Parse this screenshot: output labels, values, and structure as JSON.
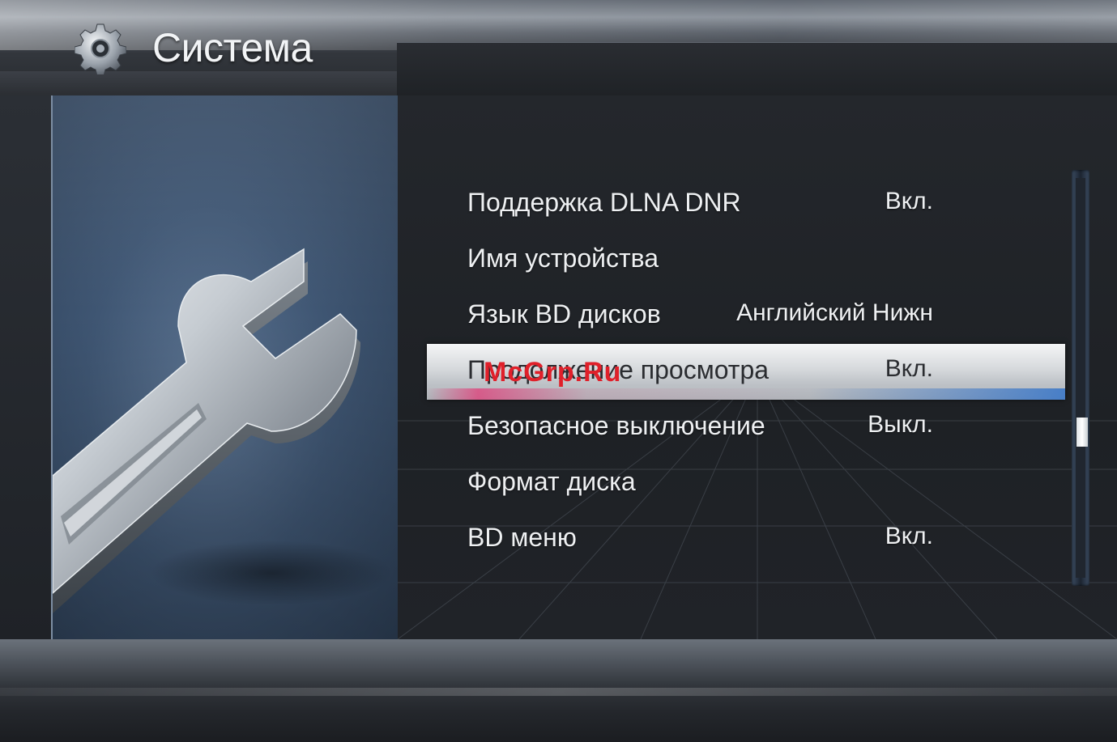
{
  "header": {
    "title": "Система",
    "icon": "gear-icon"
  },
  "illustration": {
    "icon": "wrench-icon"
  },
  "menu": {
    "items": [
      {
        "label": "Поддержка DLNA DNR",
        "value": "Вкл."
      },
      {
        "label": "Имя устройства",
        "value": ""
      },
      {
        "label": "Язык BD дисков",
        "value": "Английский Нижн"
      },
      {
        "label": "Продолжение просмотра",
        "value": "Вкл."
      },
      {
        "label": "Безопасное выключение",
        "value": "Выкл."
      },
      {
        "label": "Формат диска",
        "value": ""
      },
      {
        "label": "BD меню",
        "value": "Вкл."
      }
    ],
    "selected_index": 3
  },
  "watermark": "McGrp.Ru",
  "colors": {
    "selection_gradient_start": "#f4f5f6",
    "selection_accent_pink": "#e13c78",
    "selection_accent_blue": "#3c78c8",
    "watermark": "#e0202a"
  }
}
